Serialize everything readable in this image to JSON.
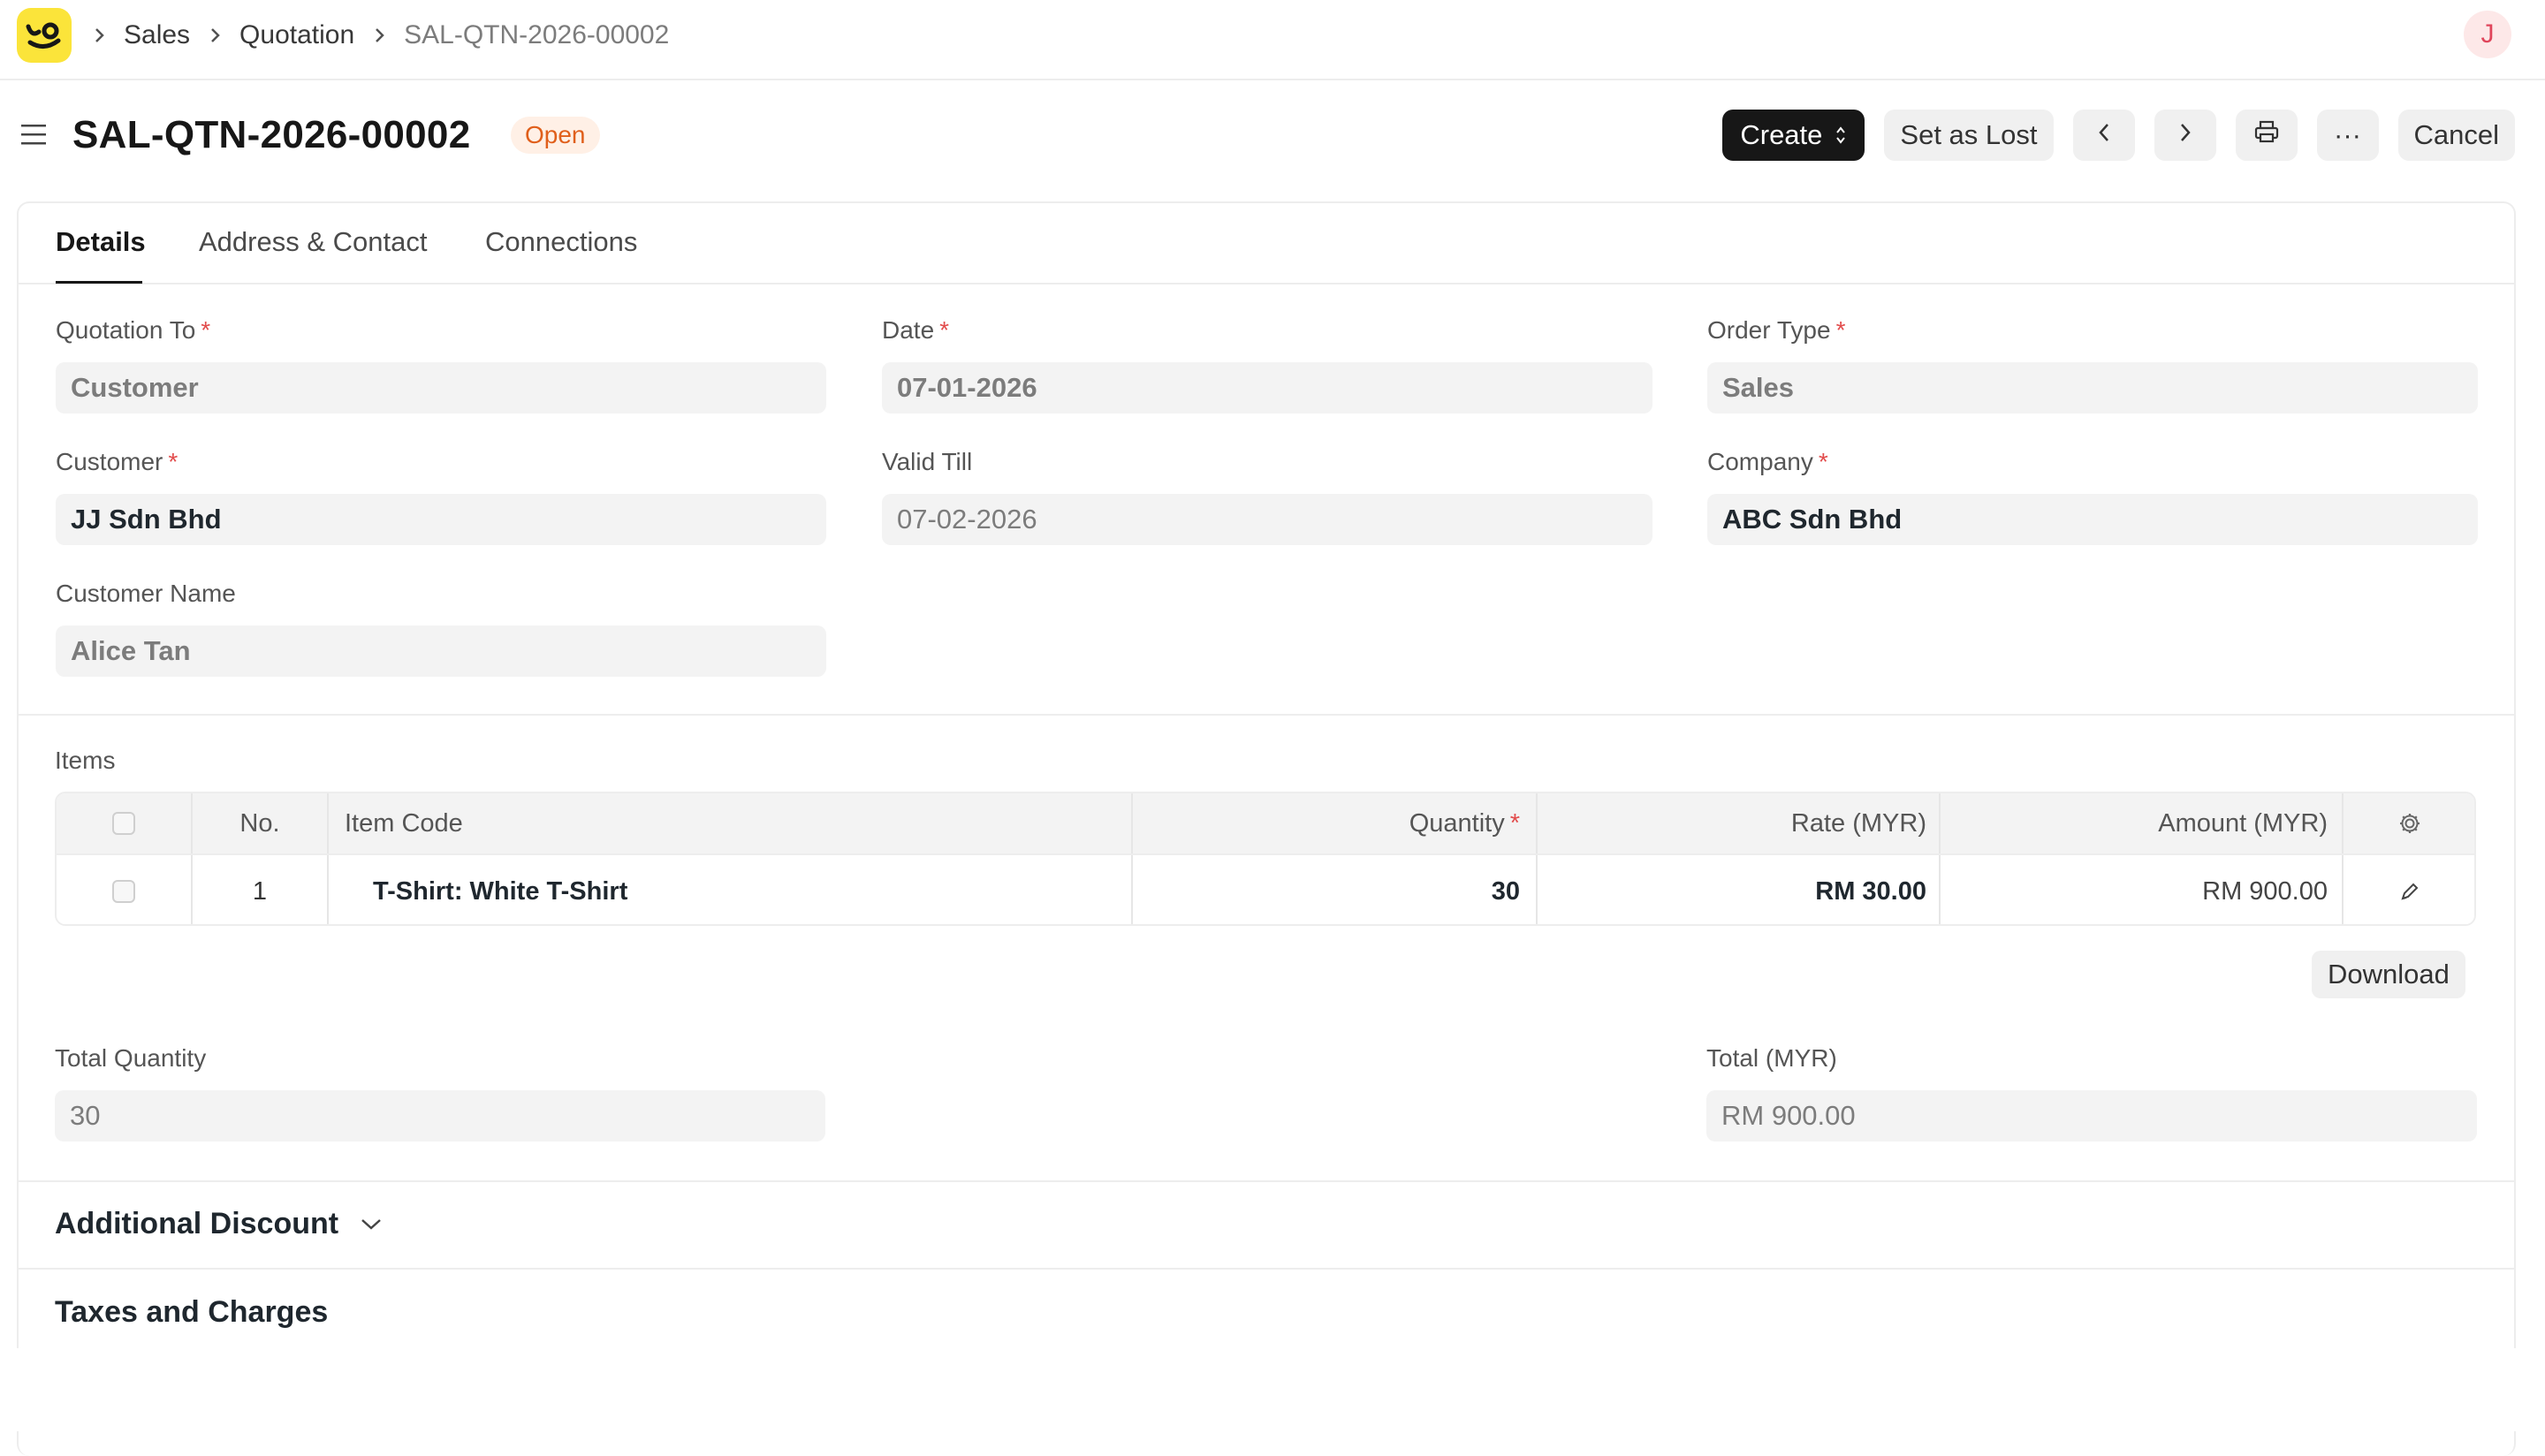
{
  "navbar": {
    "breadcrumbs": [
      "Sales",
      "Quotation",
      "SAL-QTN-2026-00002"
    ],
    "avatar_initial": "J"
  },
  "header": {
    "title": "SAL-QTN-2026-00002",
    "status": "Open",
    "actions": {
      "create": "Create",
      "set_lost": "Set as Lost",
      "cancel": "Cancel",
      "more": "···"
    }
  },
  "tabs": [
    "Details",
    "Address & Contact",
    "Connections"
  ],
  "fields": {
    "quotation_to": {
      "label": "Quotation To",
      "value": "Customer"
    },
    "date": {
      "label": "Date",
      "value": "07-01-2026"
    },
    "order_type": {
      "label": "Order Type",
      "value": "Sales"
    },
    "customer": {
      "label": "Customer",
      "value": "JJ Sdn Bhd"
    },
    "valid_till": {
      "label": "Valid Till",
      "value": "07-02-2026"
    },
    "company": {
      "label": "Company",
      "value": "ABC Sdn Bhd"
    },
    "customer_name": {
      "label": "Customer Name",
      "value": "Alice Tan"
    }
  },
  "required_mark": "*",
  "items": {
    "label": "Items",
    "columns": {
      "no": "No.",
      "item_code": "Item Code",
      "quantity": "Quantity",
      "rate": "Rate (MYR)",
      "amount": "Amount (MYR)"
    },
    "rows": [
      {
        "no": "1",
        "item_code": "T-Shirt: White T-Shirt",
        "quantity": "30",
        "rate": "RM 30.00",
        "amount": "RM 900.00"
      }
    ],
    "download": "Download"
  },
  "totals": {
    "total_qty": {
      "label": "Total Quantity",
      "value": "30"
    },
    "total": {
      "label": "Total (MYR)",
      "value": "RM 900.00"
    }
  },
  "sections": {
    "additional_discount": "Additional Discount",
    "taxes_charges": "Taxes and Charges"
  },
  "colors": {
    "accent": "#171717",
    "status_open_bg": "#fff0e6",
    "status_open_text": "#e05f1b",
    "logo_bg": "#fbe43a"
  },
  "icons": [
    "app-logo-icon",
    "chevron-right-icon",
    "hamburger-icon",
    "updown-icon",
    "chevron-left-icon",
    "printer-icon",
    "gear-icon",
    "pencil-icon",
    "chevron-down-icon"
  ]
}
